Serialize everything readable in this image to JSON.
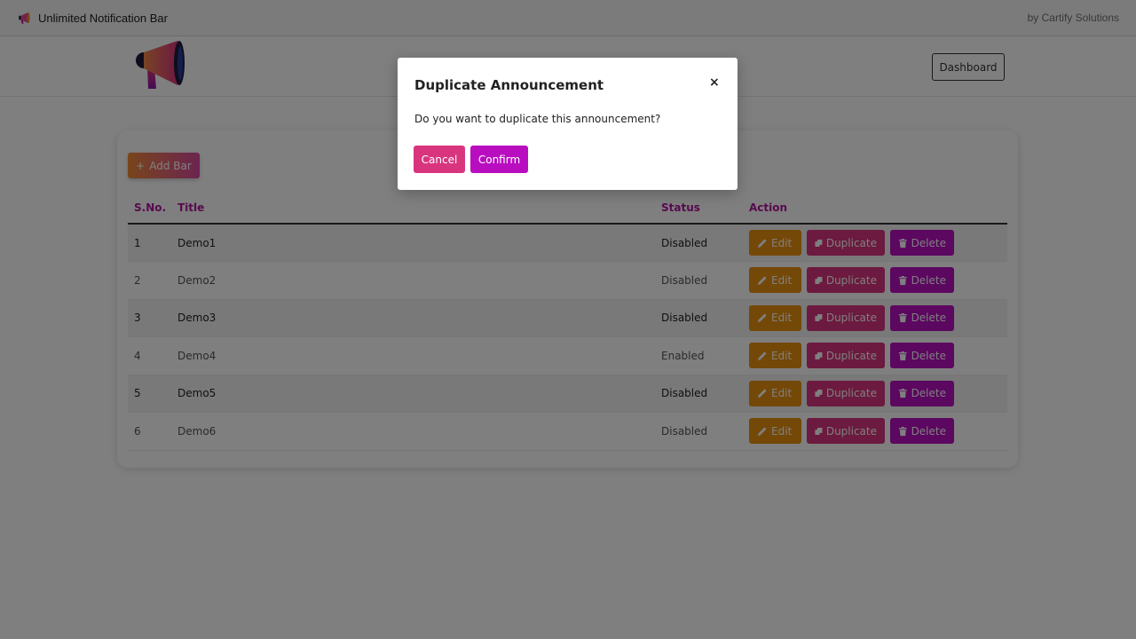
{
  "topbar": {
    "app_title": "Unlimited Notification Bar",
    "by_text": "by Cartify Solutions"
  },
  "header": {
    "dashboard_label": "Dashboard"
  },
  "toolbar": {
    "add_label": "Add Bar"
  },
  "table": {
    "headers": {
      "sno": "S.No.",
      "title": "Title",
      "status": "Status",
      "action": "Action"
    },
    "rows": [
      {
        "sno": "1",
        "title": "Demo1",
        "status": "Disabled"
      },
      {
        "sno": "2",
        "title": "Demo2",
        "status": "Disabled"
      },
      {
        "sno": "3",
        "title": "Demo3",
        "status": "Disabled"
      },
      {
        "sno": "4",
        "title": "Demo4",
        "status": "Enabled"
      },
      {
        "sno": "5",
        "title": "Demo5",
        "status": "Disabled"
      },
      {
        "sno": "6",
        "title": "Demo6",
        "status": "Disabled"
      }
    ],
    "actions": {
      "edit": "Edit",
      "duplicate": "Duplicate",
      "delete": "Delete"
    }
  },
  "modal": {
    "title": "Duplicate Announcement",
    "close": "×",
    "body": "Do you want to duplicate this announcement?",
    "cancel_label": "Cancel",
    "confirm_label": "Confirm"
  },
  "colors": {
    "accent": "#b80ec0",
    "secondary": "#d9357f",
    "warning": "#e8900f"
  },
  "icons": {
    "add": "plus-icon",
    "edit": "pencil-icon",
    "duplicate": "copy-icon",
    "delete": "trash-icon",
    "logo": "megaphone-icon"
  }
}
